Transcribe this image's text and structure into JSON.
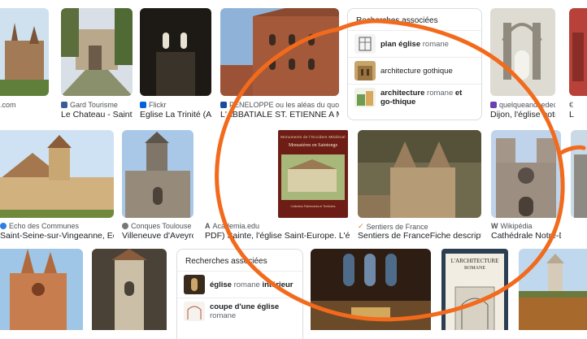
{
  "row1": [
    {
      "source": ".com",
      "caption": "",
      "fav": "#c6c6c6"
    },
    {
      "source": "Gard Tourisme",
      "caption": "Le Chateau - Saint-…",
      "fav": "#3b5a9a"
    },
    {
      "source": "Flickr",
      "caption": "Eglise La Trinité (A…",
      "fav": "#0063dc"
    },
    {
      "source": "PENELOPPE ou les aléas du quotidie…",
      "caption": "L'ABBATIALE ST. ETIENNE A MAR…",
      "fav": "#1a4ba0"
    },
    {
      "source": "quelqueandsedecul…",
      "caption": "Dijon, l'église notre-…",
      "fav": "#6a3fb0"
    },
    {
      "source": "€",
      "caption": "L",
      "fav": "#999999"
    }
  ],
  "row2": [
    {
      "source": "Echo des Communes",
      "caption": "Saint-Seine-sur-Vingeanne, Echo …",
      "fav": "#2f7de1"
    },
    {
      "source": "Conques Toulouse - …",
      "caption": "Villeneuve d'Aveyron",
      "fav": "#777777"
    },
    {
      "source": "Academia.edu",
      "caption": "PDF) Sainte, l'église Saint-Europe. L'église r…",
      "fav": "#333333"
    },
    {
      "source": "Sentiers de France",
      "caption": "Sentiers de FranceFiche descriptive - …",
      "fav": "#e07a1f"
    },
    {
      "source": "Wikipédia",
      "caption": "Cathédrale Notre-D…",
      "fav": "#555555"
    }
  ],
  "book": {
    "header": "Monuments de l'Occident Médiéval",
    "title": "Monastères en Saintonge",
    "sub": "Collection Patrimoines et Territoires"
  },
  "book2": {
    "title": "L'ARCHITECTURE",
    "sub": "ROMANE"
  },
  "related1": {
    "header": "Recherches associées",
    "items": [
      {
        "bold": "plan église",
        "rest": " romane",
        "thumb": "plan"
      },
      {
        "bold": "",
        "rest": "architecture gothique",
        "thumb": "gothic"
      },
      {
        "bold": "architecture",
        "rest": " romane ",
        "bold2": "et go-thique",
        "thumb": "mix"
      }
    ]
  },
  "related2": {
    "header": "Recherches associées",
    "items": [
      {
        "bold": "église",
        "rest": " romane ",
        "bold2": "intérieur",
        "thumb": "interior"
      },
      {
        "bold": "coupe d'une église",
        "rest": " romane",
        "thumb": "section"
      }
    ]
  },
  "colors": {
    "annotation": "#f26a1b",
    "border": "#dadce0"
  }
}
